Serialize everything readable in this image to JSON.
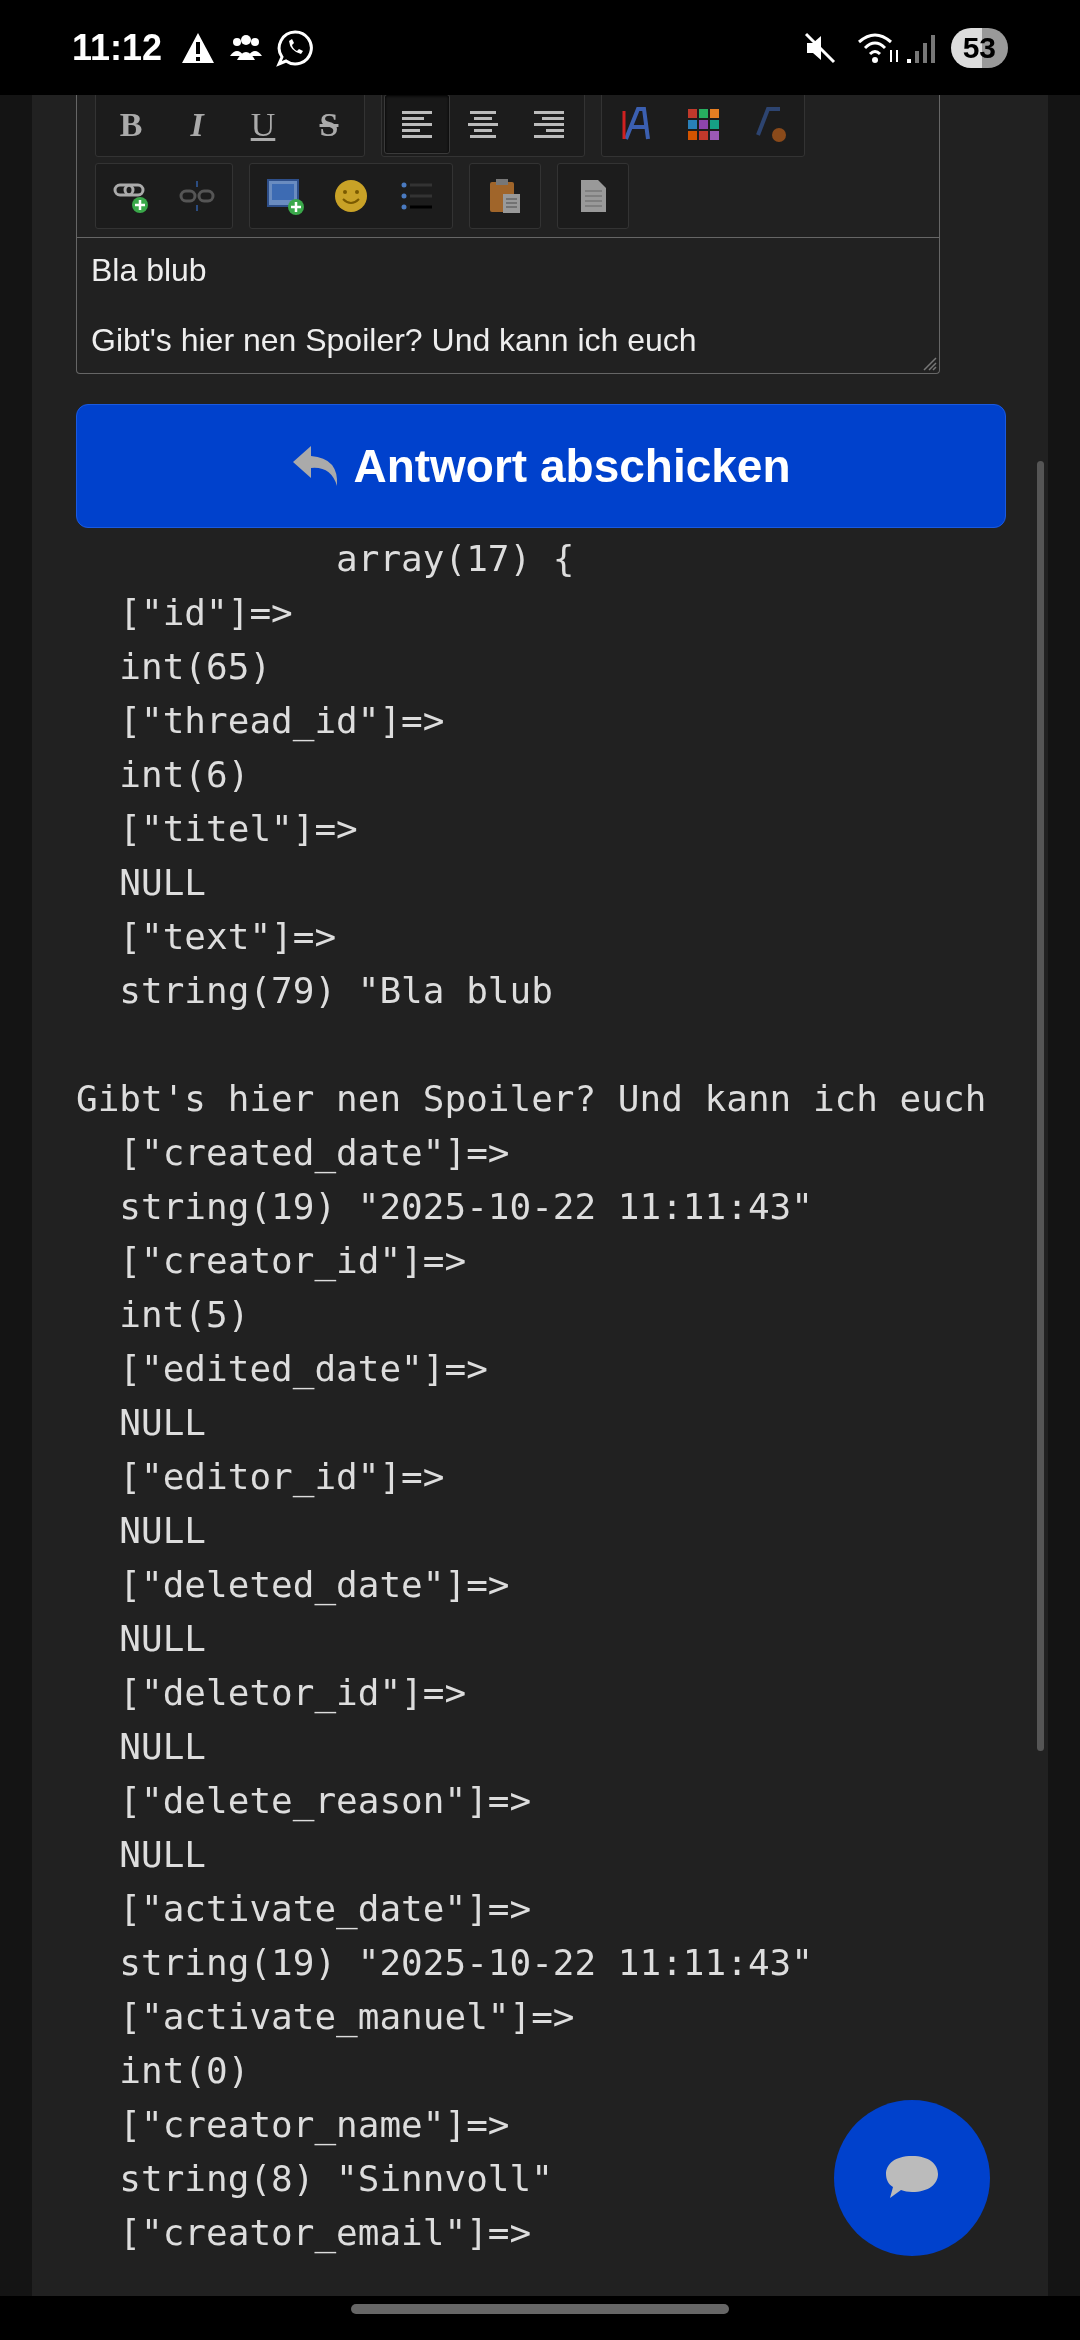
{
  "status_bar": {
    "time": "11:12",
    "battery": "53"
  },
  "editor": {
    "toolbar_rows": [
      [
        [
          {
            "kind": "bold",
            "label": "B",
            "selected": false
          },
          {
            "kind": "italic",
            "label": "I",
            "selected": false
          },
          {
            "kind": "underline",
            "label": "U",
            "selected": false
          },
          {
            "kind": "strike",
            "label": "S",
            "selected": false
          }
        ],
        [
          {
            "kind": "align-left",
            "selected": true
          },
          {
            "kind": "align-center",
            "selected": false
          },
          {
            "kind": "align-right",
            "selected": false
          }
        ],
        [
          {
            "kind": "text-color",
            "selected": false
          },
          {
            "kind": "color-grid",
            "selected": false
          },
          {
            "kind": "remove-format",
            "selected": false
          }
        ]
      ],
      [
        [
          {
            "kind": "link",
            "selected": false
          },
          {
            "kind": "unlink",
            "selected": false
          }
        ],
        [
          {
            "kind": "image",
            "selected": false
          },
          {
            "kind": "smiley",
            "selected": false
          },
          {
            "kind": "list",
            "selected": false
          }
        ],
        [
          {
            "kind": "paste",
            "selected": false
          }
        ],
        [
          {
            "kind": "document",
            "selected": false
          }
        ]
      ]
    ],
    "text_lines": [
      "Bla blub",
      "Gibt's hier nen Spoiler? Und kann ich euch"
    ]
  },
  "submit_button": "Antwort abschicken",
  "code_lines": [
    {
      "text": "            array(17) {"
    },
    {
      "text": "  [\"id\"]=>"
    },
    {
      "text": "  int(65)"
    },
    {
      "text": "  [\"thread_id\"]=>"
    },
    {
      "text": "  int(6)"
    },
    {
      "text": "  [\"titel\"]=>"
    },
    {
      "text": "  NULL"
    },
    {
      "text": "  [\"text\"]=>"
    },
    {
      "text": "  string(79) \"Bla blub\n\nGibt's hier nen Spoiler? Und kann ich euch"
    },
    {
      "text": "  [\"created_date\"]=>"
    },
    {
      "text": "  string(19) \"2025-10-22 11:11:43\""
    },
    {
      "text": "  [\"creator_id\"]=>"
    },
    {
      "text": "  int(5)"
    },
    {
      "text": "  [\"edited_date\"]=>"
    },
    {
      "text": "  NULL"
    },
    {
      "text": "  [\"editor_id\"]=>"
    },
    {
      "text": "  NULL"
    },
    {
      "text": "  [\"deleted_date\"]=>"
    },
    {
      "text": "  NULL"
    },
    {
      "text": "  [\"deletor_id\"]=>"
    },
    {
      "text": "  NULL"
    },
    {
      "text": "  [\"delete_reason\"]=>"
    },
    {
      "text": "  NULL"
    },
    {
      "text": "  [\"activate_date\"]=>"
    },
    {
      "text": "  string(19) \"2025-10-22 11:11:43\""
    },
    {
      "text": "  [\"activate_manuel\"]=>"
    },
    {
      "text": "  int(0)"
    },
    {
      "text": "  [\"creator_name\"]=>"
    },
    {
      "text": "  string(8) \"Sinnvoll\""
    },
    {
      "text": "  [\"creator_email\"]=>"
    }
  ]
}
